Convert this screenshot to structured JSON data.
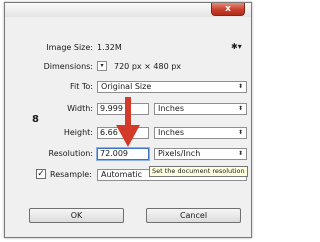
{
  "window": {
    "close_label": "x"
  },
  "image_size": {
    "label": "Image Size:",
    "value": "1.32M"
  },
  "dimensions": {
    "label": "Dimensions:",
    "toggle_glyph": "▾",
    "value": "720 px × 480 px"
  },
  "fit_to": {
    "label": "Fit To:",
    "value": "Original Size"
  },
  "link": {
    "glyph": "8"
  },
  "width": {
    "label": "Width:",
    "value": "9.999",
    "unit": "Inches"
  },
  "height": {
    "label": "Height:",
    "value": "6.66",
    "unit": "Inches"
  },
  "resolution": {
    "label": "Resolution:",
    "value": "72.009",
    "unit": "Pixels/Inch"
  },
  "resample": {
    "label": "Resample:",
    "checked": true,
    "check_glyph": "✓",
    "value": "Automatic"
  },
  "tooltip": {
    "text": "Set the document resolution"
  },
  "buttons": {
    "ok": "OK",
    "cancel": "Cancel"
  },
  "icons": {
    "gear": "✱▾",
    "select_arrows": "⬍"
  },
  "annotation": {
    "arrow_color": "#d43a2a"
  }
}
